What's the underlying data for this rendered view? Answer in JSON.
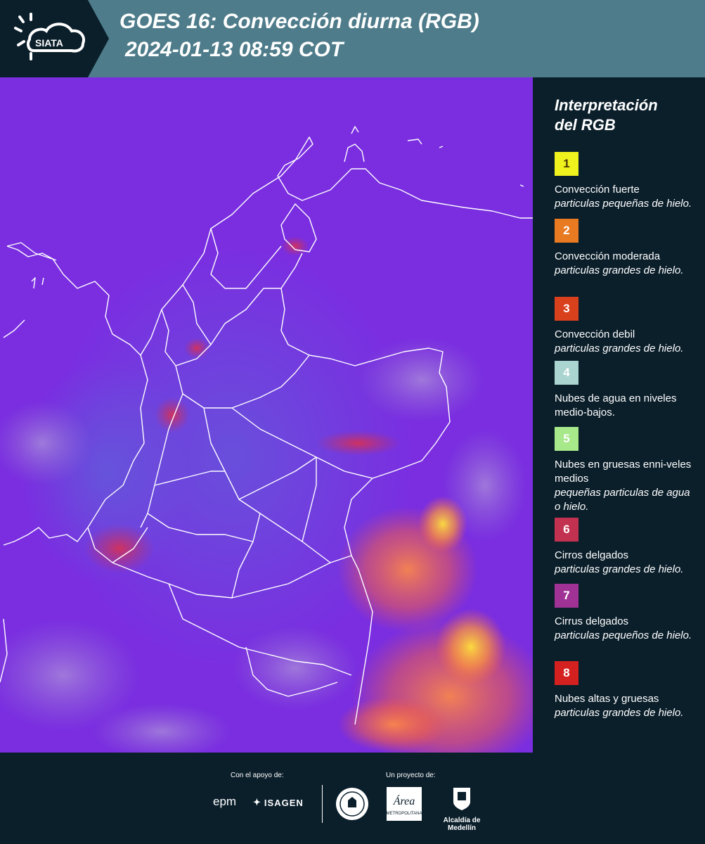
{
  "header": {
    "logo_text": "SIATA",
    "title_line1": "GOES 16: Convección diurna (RGB)",
    "title_line2": "2024-01-13 08:59 COT"
  },
  "map": {
    "background_color": "#7a2ee0",
    "boundary_color": "#ffffff"
  },
  "legend": {
    "title_line1": "Interpretación",
    "title_line2": "del RGB",
    "items": [
      {
        "number": "1",
        "color": "#f0f21e",
        "text_color": "#4a3b00",
        "name": "Convección fuerte",
        "desc": "particulas pequeñas de hielo."
      },
      {
        "number": "2",
        "color": "#e87a22",
        "text_color": "#ffffff",
        "name": "Convección moderada",
        "desc": "particulas grandes de hielo."
      },
      {
        "number": "3",
        "color": "#d9401c",
        "text_color": "#ffffff",
        "name": "Convección debil",
        "desc": "particulas grandes de hielo."
      },
      {
        "number": "4",
        "color": "#a9d4cf",
        "text_color": "#ffffff",
        "name": "Nubes de agua en niveles medio-bajos.",
        "desc": ""
      },
      {
        "number": "5",
        "color": "#a7e88a",
        "text_color": "#ffffff",
        "name": "Nubes en gruesas enni-veles medios",
        "desc": "pequeñas particulas de agua o hielo."
      },
      {
        "number": "6",
        "color": "#c23150",
        "text_color": "#ffffff",
        "name": "Cirros delgados",
        "desc": "particulas grandes de hielo."
      },
      {
        "number": "7",
        "color": "#a03296",
        "text_color": "#ffffff",
        "name": "Cirrus delgados",
        "desc": "particulas pequeños de hielo."
      },
      {
        "number": "8",
        "color": "#d4211f",
        "text_color": "#ffffff",
        "name": "Nubes altas y gruesas",
        "desc": "particulas grandes de hielo."
      }
    ]
  },
  "footer": {
    "support_label": "Con el apoyo de:",
    "project_label": "Un proyecto de:",
    "epm_text": "epm",
    "isagen_text": "ISAGEN",
    "area_text": "Área",
    "area_sub": "METROPOLITANA",
    "medellin_text": "Alcaldía de Medellín"
  }
}
